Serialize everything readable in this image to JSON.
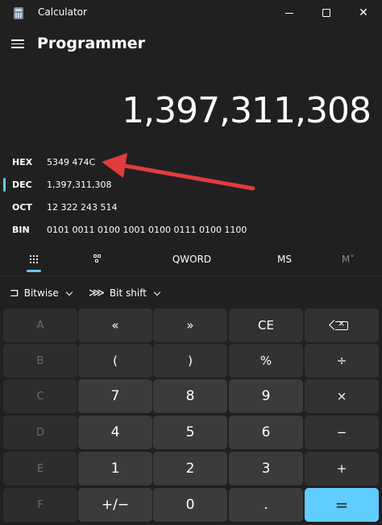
{
  "window": {
    "title": "Calculator",
    "icons": {
      "app": "calculator-icon",
      "minimize": "minimize-icon",
      "maximize": "maximize-icon",
      "close": "close-icon"
    },
    "close_glyph": "✕"
  },
  "header": {
    "menu_icon": "hamburger-menu-icon",
    "mode": "Programmer"
  },
  "display": {
    "value": "1,397,311,308"
  },
  "radix": {
    "hex": {
      "label": "HEX",
      "value": "5349 474C"
    },
    "dec": {
      "label": "DEC",
      "value": "1,397,311,308",
      "selected": true
    },
    "oct": {
      "label": "OCT",
      "value": "12 322 243 514"
    },
    "bin": {
      "label": "BIN",
      "value": "0101 0011 0100 1001 0100 0111 0100 1100"
    }
  },
  "annotation": {
    "type": "red-arrow",
    "color": "#e03c3c",
    "points_to": "hex-value"
  },
  "tabs": {
    "keypad_icon": "full-keypad-icon",
    "bits_icon": "bit-toggling-keypad-icon",
    "word_size": "QWORD",
    "memory_store": "MS",
    "memory_recall": "M˅"
  },
  "toolbar": {
    "bitwise": {
      "label": "Bitwise",
      "icon": "logic-gate-icon",
      "glyph": "⊐"
    },
    "bitshift": {
      "label": "Bit shift",
      "icon": "bit-shift-icon",
      "glyph": "⋙"
    }
  },
  "keys": {
    "r1": [
      "A",
      "«",
      "»",
      "CE",
      "backspace"
    ],
    "r2": [
      "B",
      "(",
      ")",
      "%",
      "÷"
    ],
    "r3": [
      "C",
      "7",
      "8",
      "9",
      "×"
    ],
    "r4": [
      "D",
      "4",
      "5",
      "6",
      "−"
    ],
    "r5": [
      "E",
      "1",
      "2",
      "3",
      "+"
    ],
    "r6": [
      "F",
      "+/−",
      "0",
      ".",
      "="
    ]
  },
  "colors": {
    "background": "#202020",
    "accent": "#60cdff",
    "key_number": "#3b3b3b",
    "key_operator": "#323232",
    "key_disabled": "#2d2d2d"
  }
}
